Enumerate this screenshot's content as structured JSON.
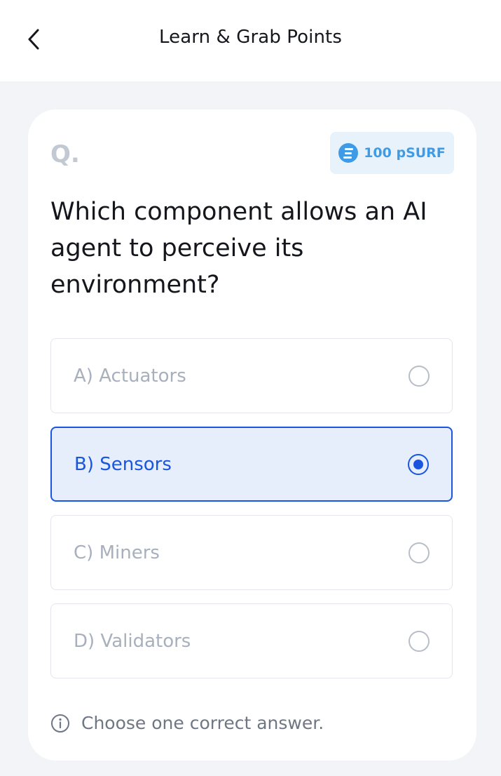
{
  "header": {
    "title": "Learn & Grab Points",
    "back_icon": "chevron-left-icon"
  },
  "question_card": {
    "q_label": "Q.",
    "reward": {
      "icon": "psurf-token-icon",
      "amount_text": "100 pSURF",
      "color": "#3f9be6"
    },
    "question_text": "Which component allows an AI agent to perceive its environment?",
    "options": [
      {
        "label": "A) Actuators",
        "selected": false
      },
      {
        "label": "B) Sensors",
        "selected": true
      },
      {
        "label": "C) Miners",
        "selected": false
      },
      {
        "label": "D) Validators",
        "selected": false
      }
    ],
    "hint": {
      "icon": "info-icon",
      "text": "Choose one correct answer."
    }
  },
  "colors": {
    "accent": "#1a55e0",
    "selected_background": "#e6eefc",
    "page_background": "#f2f4f8"
  }
}
